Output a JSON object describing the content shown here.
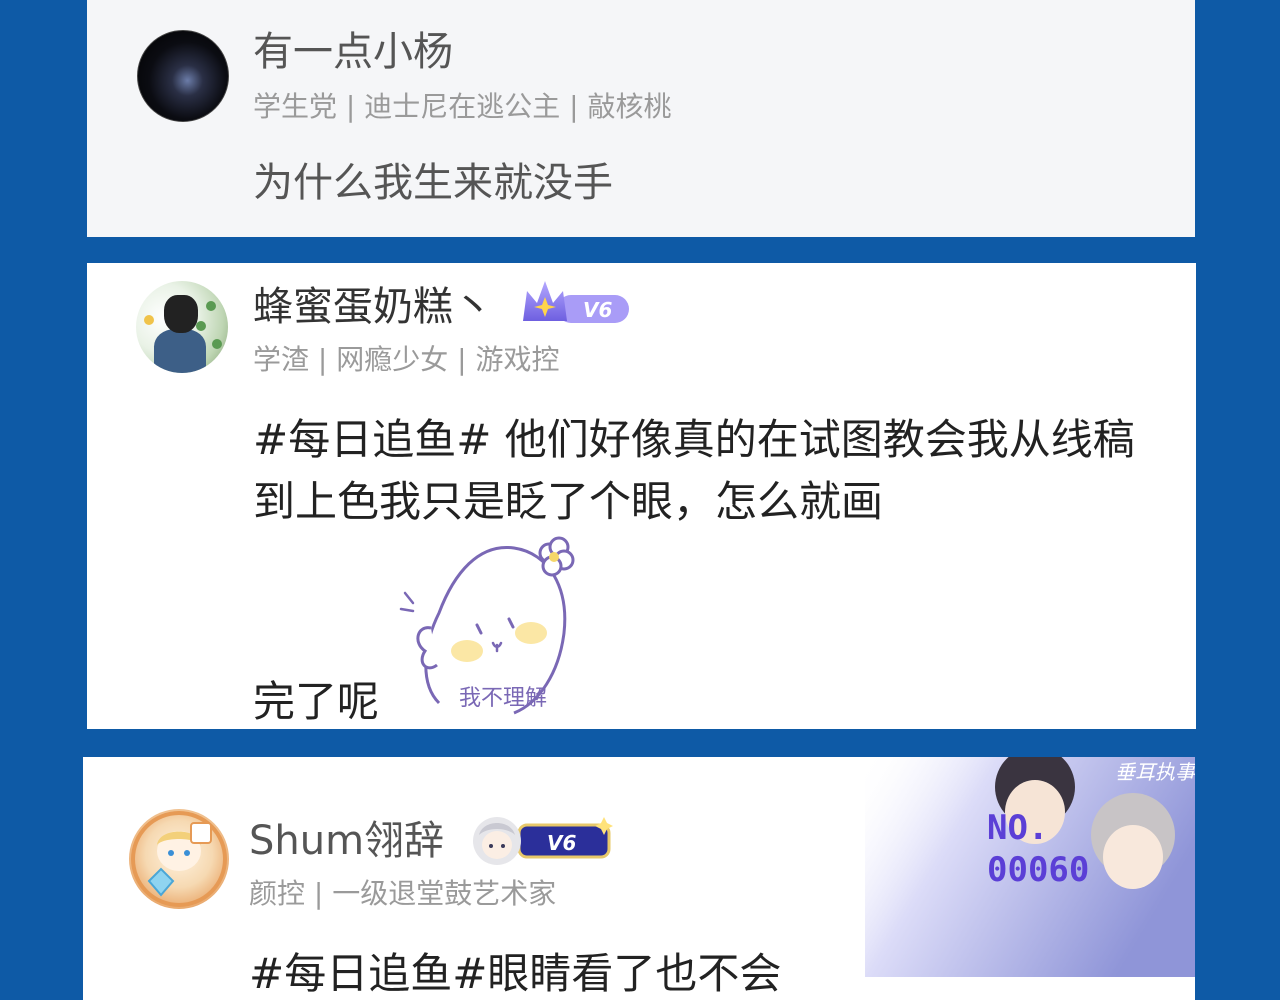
{
  "posts": [
    {
      "name": "有一点小杨",
      "tags": "学生党 | 迪士尼在逃公主 | 敲核桃",
      "body": "为什么我生来就没手"
    },
    {
      "name": "蜂蜜蛋奶糕丶",
      "badge": "V6",
      "tags": "学渣 | 网瘾少女 | 游戏控",
      "body_line1": "#每日追鱼# 他们好像真的在试图教会我从线稿到上色我只是眨了个眼，怎么就画",
      "body_line2": "完了呢",
      "sticker_text": "我不理解"
    },
    {
      "name": "Shum翎辞",
      "badge": "V6",
      "tags": "颜控 | 一级退堂鼓艺术家",
      "body": "#每日追鱼#眼睛看了也不会",
      "banner_title": "垂耳执事",
      "banner_no_1": "NO.",
      "banner_no_2": "00060"
    }
  ],
  "colors": {
    "page_background": "#0e5aa6",
    "card1_background": "#f5f6f8",
    "badge_purple": "#8a7cf0",
    "banner_number": "#5b3fd6"
  },
  "icons": [
    "crown-v6-badge-icon",
    "chibi-v6-badge-icon",
    "seal-sticker-icon"
  ]
}
